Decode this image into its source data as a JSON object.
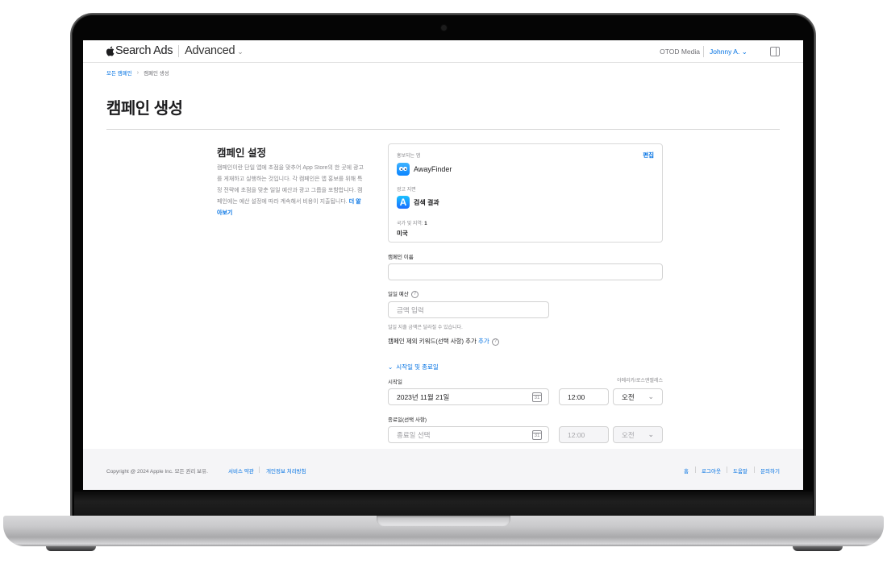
{
  "header": {
    "brand": "Search Ads",
    "product": "Advanced",
    "account": "OTOD Media",
    "user": "Johnny A."
  },
  "breadcrumb": {
    "parent": "모든 캠페인",
    "current": "캠페인 생성"
  },
  "page_title": "캠페인 생성",
  "settings": {
    "title": "캠페인 설정",
    "description": "캠페인이란 단일 앱에 초점을 맞추어 App Store의 한 곳에 광고를 게재하고 실행하는 것입니다. 각 캠페인은 앱 홍보를 위해 특정 전략에 초점을 맞춘 일일 예산과 광고 그룹을 포함합니다. 캠페인에는 예산 설정에 따라 계속해서 비용이 지출됩니다.",
    "learn_more": "더 알아보기"
  },
  "summary": {
    "promoted_app_label": "홍보되는 앱",
    "edit_label": "편집",
    "app_name": "AwayFinder",
    "placement_label": "광고 지면",
    "placement_value": "검색 결과",
    "countries_label": "국가 및 지역:",
    "countries_count": "1",
    "country": "미국"
  },
  "form": {
    "campaign_name_label": "캠페인 이름",
    "campaign_name_value": "",
    "daily_budget_label": "일일 예산",
    "daily_budget_placeholder": "금액 입력",
    "daily_budget_hint": "일일 지출 금액은 달라질 수 있습니다.",
    "negative_keywords_label": "캠페인 제외 키워드(선택 사항) 추가",
    "negative_keywords_link": "추가",
    "dates_toggle": "시작일 및 종료일",
    "start_label": "시작일",
    "timezone": "아메리카/로스앤젤레스",
    "start_date": "2023년 11월 21일",
    "start_time": "12:00",
    "start_ampm": "오전",
    "end_label": "종료일(선택 사항)",
    "end_date_placeholder": "종료일 선택",
    "end_time": "12:00",
    "end_ampm": "오전",
    "calendar_day": "31"
  },
  "footer": {
    "copyright": "Copyright @ 2024 Apple Inc. 모든 권리 보유.",
    "terms": "서비스 약관",
    "privacy": "개인정보 처리방침",
    "links": [
      "홈",
      "로그아웃",
      "도움말",
      "문의하기"
    ]
  }
}
